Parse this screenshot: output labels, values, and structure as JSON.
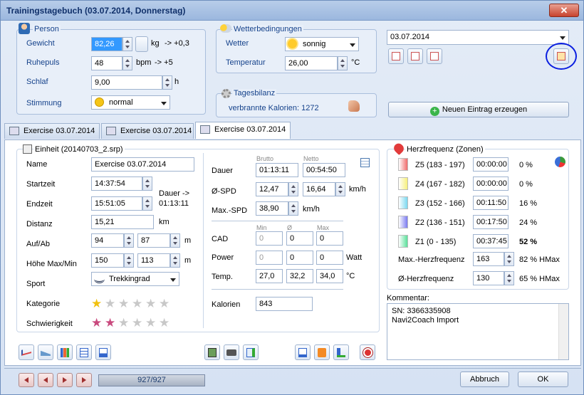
{
  "window": {
    "title": "Trainingstagebuch (03.07.2014, Donnerstag)",
    "close": "✕"
  },
  "person": {
    "title": "Person",
    "weight_label": "Gewicht",
    "weight": "82,26",
    "weight_unit": "kg",
    "weight_delta": "-> +0,3",
    "pulse_label": "Ruhepuls",
    "pulse": "48",
    "pulse_unit": "bpm",
    "pulse_delta": "-> +5",
    "sleep_label": "Schlaf",
    "sleep": "9,00",
    "sleep_unit": "h",
    "mood_label": "Stimmung",
    "mood": "normal"
  },
  "weather": {
    "title": "Wetterbedingungen",
    "weather_label": "Wetter",
    "weather": "sonnig",
    "temp_label": "Temperatur",
    "temp": "26,00",
    "temp_unit": "°C"
  },
  "balance": {
    "title": "Tagesbilanz",
    "calories_text": "verbrannte Kalorien: 1272"
  },
  "date": {
    "value": "03.07.2014",
    "new_entry": "Neuen Eintrag erzeugen"
  },
  "tabs": [
    "Exercise 03.07.2014",
    "Exercise 03.07.2014",
    "Exercise 03.07.2014"
  ],
  "unit": {
    "title": "Einheit (20140703_2.srp)",
    "name_label": "Name",
    "name": "Exercise 03.07.2014",
    "start_label": "Startzeit",
    "start": "14:37:54",
    "end_label": "Endzeit",
    "end": "15:51:05",
    "dur_note": "Dauer ->",
    "dur_note_val": "01:13:11",
    "dist_label": "Distanz",
    "dist": "15,21",
    "dist_unit": "km",
    "updown_label": "Auf/Ab",
    "up": "94",
    "down": "87",
    "updown_unit": "m",
    "height_label": "Höhe Max/Min",
    "hmax": "150",
    "hmin": "113",
    "height_unit": "m",
    "sport_label": "Sport",
    "sport": "Trekkingrad",
    "cat_label": "Kategorie",
    "diff_label": "Schwierigkeit",
    "cat_stars": 1,
    "diff_stars": 2
  },
  "stats": {
    "brutto": "Brutto",
    "netto": "Netto",
    "dur_label": "Dauer",
    "dur_b": "01:13:11",
    "dur_n": "00:54:50",
    "spd_label": "Ø-SPD",
    "spd_b": "12,47",
    "spd_n": "16,64",
    "spd_unit": "km/h",
    "maxspd_label": "Max.-SPD",
    "maxspd": "38,90",
    "maxspd_unit": "km/h",
    "min": "Min",
    "avg": "Ø",
    "max": "Max",
    "cad_label": "CAD",
    "cad": [
      "0",
      "0",
      "0"
    ],
    "power_label": "Power",
    "power": [
      "0",
      "0",
      "0"
    ],
    "power_unit": "Watt",
    "temp_label": "Temp.",
    "temp": [
      "27,0",
      "32,2",
      "34,0"
    ],
    "temp_unit": "°C",
    "kcal_label": "Kalorien",
    "kcal": "843"
  },
  "hr": {
    "title": "Herzfrequenz (Zonen)",
    "zones": [
      {
        "label": "Z5 (183 - 197)",
        "time": "00:00:00",
        "pct": "0 %",
        "color": "#f06a6a"
      },
      {
        "label": "Z4 (167 - 182)",
        "time": "00:00:00",
        "pct": "0 %",
        "color": "#f6f07a"
      },
      {
        "label": "Z3 (152 - 166)",
        "time": "00:11:50",
        "pct": "16 %",
        "color": "#7ad8f0"
      },
      {
        "label": "Z2 (136 - 151)",
        "time": "00:17:50",
        "pct": "24 %",
        "color": "#7a7af0"
      },
      {
        "label": "Z1 (0 - 135)",
        "time": "00:37:45",
        "pct": "52 %",
        "color": "#5ae09a"
      }
    ],
    "max_label": "Max.-Herzfrequenz",
    "max": "163",
    "max_pct": "82 % HMax",
    "avg_label": "Ø-Herzfrequenz",
    "avg": "130",
    "avg_pct": "65 % HMax"
  },
  "comment": {
    "label": "Kommentar:",
    "line1": "SN: 3366335908",
    "line2": "Navi2Coach Import"
  },
  "footer": {
    "counter": "927/927",
    "cancel": "Abbruch",
    "ok": "OK"
  }
}
